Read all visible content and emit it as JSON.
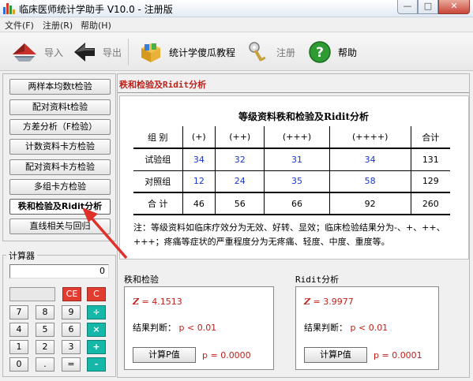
{
  "window": {
    "title": "临床医师统计学助手 V10.0 - 注册版"
  },
  "menu": [
    "文件(F)",
    "注册(R)",
    "帮助(H)"
  ],
  "toolbar": {
    "import": "导入",
    "export": "导出",
    "tutorial": "统计学傻瓜教程",
    "register": "注册",
    "help": "帮助"
  },
  "nav": [
    "两样本均数t检验",
    "配对资料t检验",
    "方差分析（F检验）",
    "计数资料卡方检验",
    "配对资料卡方检验",
    "多组卡方检验",
    "秩和检验及Ridit分析",
    "直线相关与回归"
  ],
  "calculator": {
    "title": "计算器",
    "display": "0",
    "keys": {
      "ce": "CE",
      "c": "C",
      "k7": "7",
      "k8": "8",
      "k9": "9",
      "div": "÷",
      "k4": "4",
      "k5": "5",
      "k6": "6",
      "mul": "×",
      "k1": "1",
      "k2": "2",
      "k3": "3",
      "add": "+",
      "k0": "0",
      "dot": ".",
      "eq": "=",
      "sub": "-"
    }
  },
  "main": {
    "title": "秩和检验及Ridit分析",
    "table_title": "等级资料秩和检验及Ridit分析",
    "headers": [
      "组  别",
      "(+)",
      "(++)",
      "(+++)",
      "(++++)",
      "合计"
    ],
    "rows": [
      {
        "label": "试验组",
        "values": [
          "34",
          "32",
          "31",
          "34"
        ],
        "total": "131"
      },
      {
        "label": "对照组",
        "values": [
          "12",
          "24",
          "35",
          "58"
        ],
        "total": "129"
      },
      {
        "label": "合  计",
        "values": [
          "46",
          "56",
          "66",
          "92"
        ],
        "total": "260"
      }
    ],
    "note": "注：等级资料如临床疗效分为无效、好转、显效；临床检验结果分为-、+、++、+++；疼痛等症状的严重程度分为无疼痛、轻度、中度、重度等。"
  },
  "rank_test": {
    "title": "秩和检验",
    "z_symbol": "Z",
    "z_value": "=  4.1513",
    "judge_label": "结果判断：",
    "judge_value": "p < 0.01",
    "calc_button": "计算P值",
    "p_value": "p = 0.0000"
  },
  "ridit": {
    "title": "Ridit分析",
    "z_symbol": "Z",
    "z_value": "=  3.9977",
    "judge_label": "结果判断：",
    "judge_value": "p < 0.01",
    "calc_button": "计算P值",
    "p_value": "p = 0.0001"
  },
  "colors": {
    "accent_red": "#c0201a",
    "value_blue": "#1a36c8",
    "calc_red": "#e23b2f",
    "calc_teal": "#14b7a8"
  }
}
